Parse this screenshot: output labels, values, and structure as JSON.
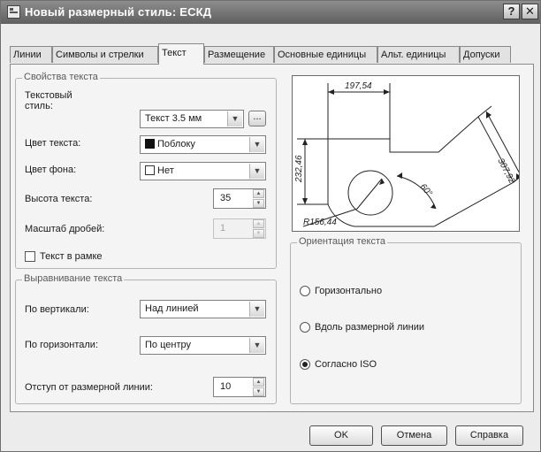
{
  "window": {
    "title": "Новый размерный стиль: ЕСКД",
    "help_label": "?",
    "close_label": "✕"
  },
  "tabs": [
    {
      "label": "Линии"
    },
    {
      "label": "Символы и стрелки"
    },
    {
      "label": "Текст"
    },
    {
      "label": "Размещение"
    },
    {
      "label": "Основные единицы"
    },
    {
      "label": "Альт. единицы"
    },
    {
      "label": "Допуски"
    }
  ],
  "active_tab": "Текст",
  "text_props": {
    "legend": "Свойства текста",
    "style_label": "Текстовый\nстиль:",
    "style_value": "Текст 3.5 мм",
    "browse_label": "...",
    "color_label": "Цвет текста:",
    "color_value": "Поблоку",
    "fill_label": "Цвет фона:",
    "fill_value": "Нет",
    "height_label": "Высота текста:",
    "height_value": "35",
    "fraction_label": "Масштаб дробей:",
    "fraction_value": "1",
    "frame_label": "Текст в рамке",
    "frame_checked": false
  },
  "alignment": {
    "legend": "Выравнивание текста",
    "vertical_label": "По вертикали:",
    "vertical_value": "Над линией",
    "horizontal_label": "По горизонтали:",
    "horizontal_value": "По центру",
    "offset_label": "Отступ от размерной линии:",
    "offset_value": "10"
  },
  "orientation": {
    "legend": "Ориентация текста",
    "options": [
      {
        "label": "Горизонтально",
        "selected": false
      },
      {
        "label": "Вдоль размерной линии",
        "selected": false
      },
      {
        "label": "Согласно ISO",
        "selected": true
      }
    ]
  },
  "preview": {
    "dim_top": "197,54",
    "dim_left": "232,46",
    "dim_right": "307,92",
    "dim_angle": "60°",
    "dim_radius": "R156,44"
  },
  "buttons": {
    "ok": "OK",
    "cancel": "Отмена",
    "help": "Справка"
  },
  "icons": {
    "combo_arrow": "chevron-down-icon",
    "spin_up": "spin-up-icon",
    "spin_down": "spin-down-icon"
  }
}
